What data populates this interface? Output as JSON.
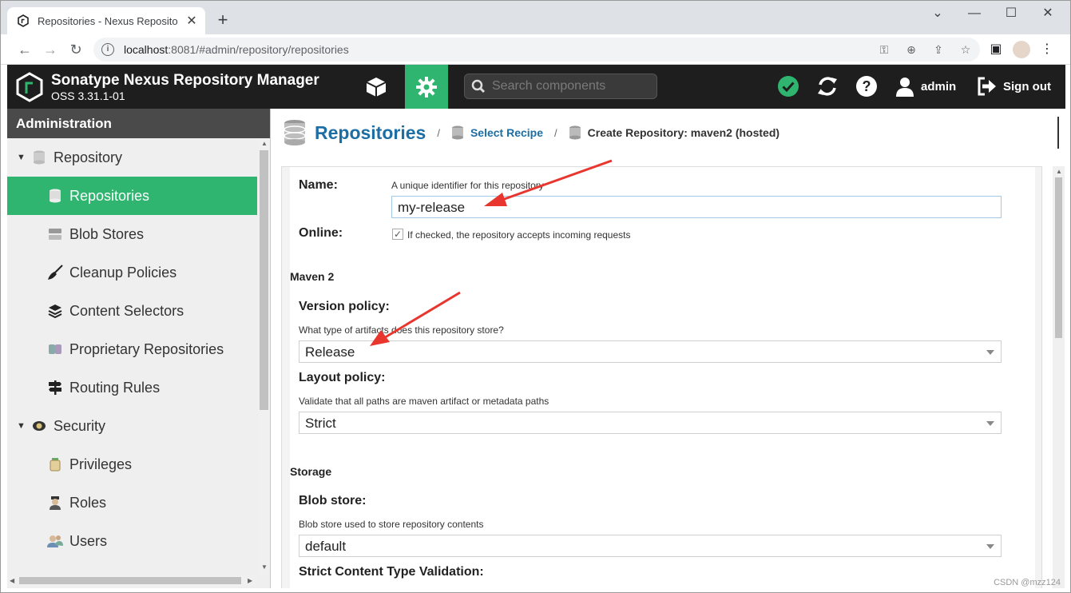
{
  "browser": {
    "tab_title": "Repositories - Nexus Reposito",
    "url_host": "localhost",
    "url_path": ":8081/#admin/repository/repositories"
  },
  "header": {
    "title": "Sonatype Nexus Repository Manager",
    "version": "OSS 3.31.1-01",
    "search_placeholder": "Search components",
    "user": "admin",
    "sign_out": "Sign out"
  },
  "sidebar": {
    "title": "Administration",
    "items": [
      {
        "label": "Repository"
      },
      {
        "label": "Repositories"
      },
      {
        "label": "Blob Stores"
      },
      {
        "label": "Cleanup Policies"
      },
      {
        "label": "Content Selectors"
      },
      {
        "label": "Proprietary Repositories"
      },
      {
        "label": "Routing Rules"
      },
      {
        "label": "Security"
      },
      {
        "label": "Privileges"
      },
      {
        "label": "Roles"
      },
      {
        "label": "Users"
      }
    ]
  },
  "breadcrumb": {
    "title": "Repositories",
    "link": "Select Recipe",
    "current": "Create Repository: maven2 (hosted)"
  },
  "form": {
    "name_label": "Name:",
    "name_help": "A unique identifier for this repository",
    "name_value": "my-release",
    "online_label": "Online:",
    "online_help": "If checked, the repository accepts incoming requests",
    "maven_section": "Maven 2",
    "version_label": "Version policy:",
    "version_help": "What type of artifacts does this repository store?",
    "version_value": "Release",
    "layout_label": "Layout policy:",
    "layout_help": "Validate that all paths are maven artifact or metadata paths",
    "layout_value": "Strict",
    "storage_section": "Storage",
    "blob_label": "Blob store:",
    "blob_help": "Blob store used to store repository contents",
    "blob_value": "default",
    "strict_label": "Strict Content Type Validation:"
  },
  "watermark": "CSDN @mzz124"
}
